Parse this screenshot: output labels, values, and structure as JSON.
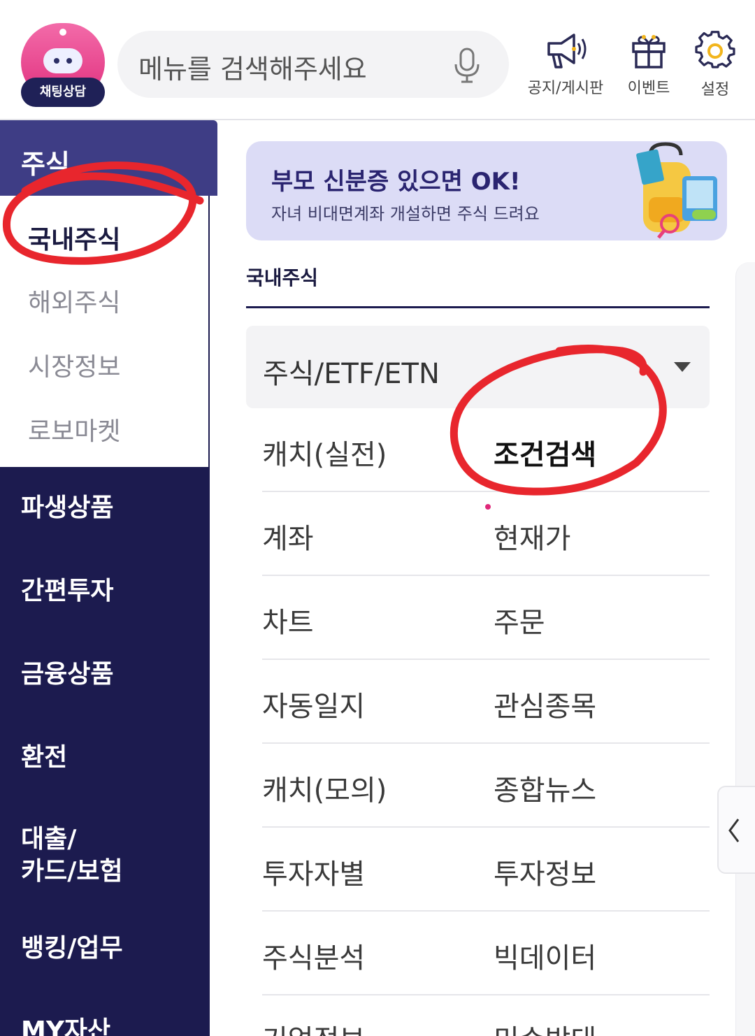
{
  "header": {
    "chatbot_label": "채팅상담",
    "search_placeholder": "메뉴를 검색해주세요",
    "icons": [
      {
        "label": "공지/게시판",
        "icon": "megaphone-icon"
      },
      {
        "label": "이벤트",
        "icon": "gift-icon"
      },
      {
        "label": "설정",
        "icon": "gear-icon"
      }
    ]
  },
  "sidebar": {
    "active_category": "주식",
    "sub_items": [
      {
        "label": "국내주식",
        "selected": true
      },
      {
        "label": "해외주식",
        "selected": false
      },
      {
        "label": "시장정보",
        "selected": false
      },
      {
        "label": "로보마켓",
        "selected": false
      }
    ],
    "categories": [
      {
        "label": "파생상품"
      },
      {
        "label": "간편투자"
      },
      {
        "label": "금융상품"
      },
      {
        "label": "환전"
      },
      {
        "label": "대출/\n카드/보험"
      },
      {
        "label": "뱅킹/업무"
      },
      {
        "label": "MY자산"
      }
    ]
  },
  "banner": {
    "title": "부모 신분증 있으면  OK!",
    "subtitle": "자녀 비대면계좌 개설하면 주식 드려요"
  },
  "main": {
    "section_title": "국내주식",
    "dropdown_value": "주식/ETF/ETN",
    "menu_rows": [
      [
        "캐치(실전)",
        "조건검색"
      ],
      [
        "계좌",
        "현재가"
      ],
      [
        "차트",
        "주문"
      ],
      [
        "자동일지",
        "관심종목"
      ],
      [
        "캐치(모의)",
        "종합뉴스"
      ],
      [
        "투자자별",
        "투자정보"
      ],
      [
        "주식분석",
        "빅데이터"
      ],
      [
        "기업정보",
        "미수방대"
      ]
    ]
  },
  "colors": {
    "nav_bg": "#1c1b4f",
    "nav_active": "#3e3d85",
    "banner_bg": "#dcdcf6",
    "annotation_red": "#e8262d"
  }
}
